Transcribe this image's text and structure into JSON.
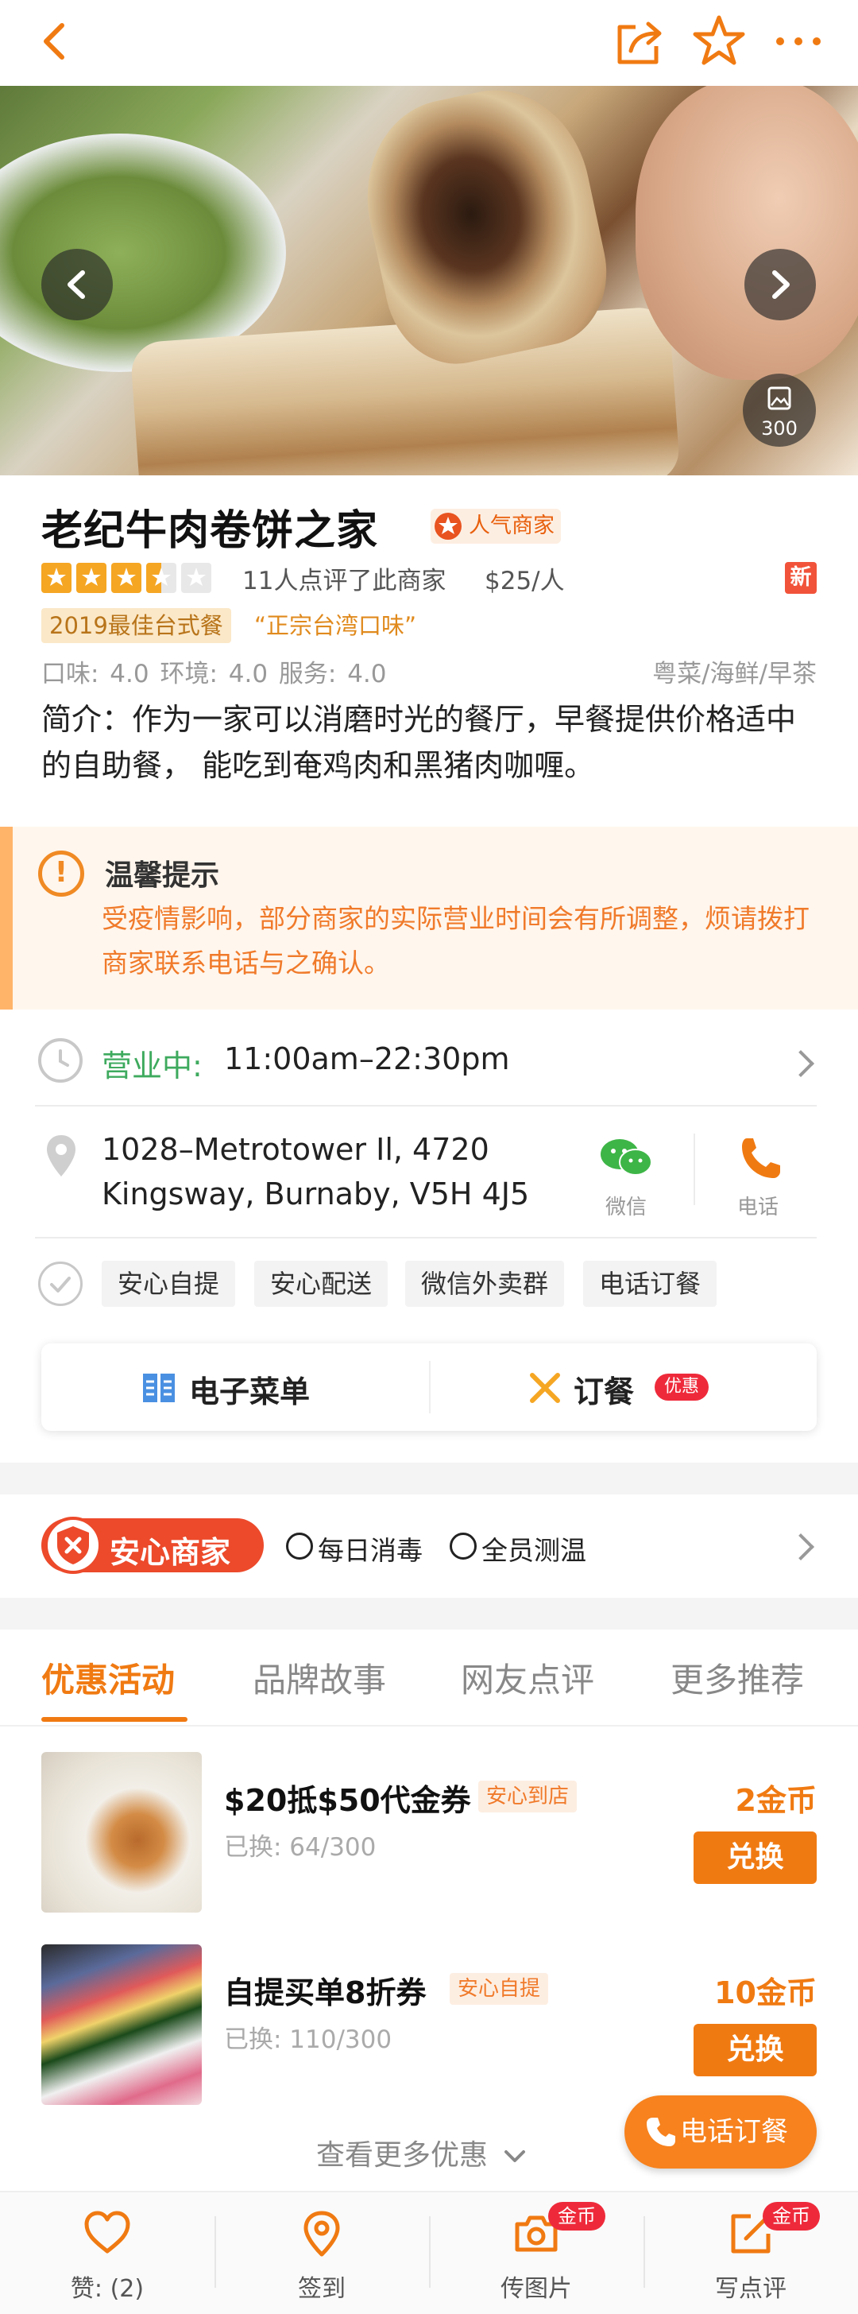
{
  "header": {},
  "hero": {
    "photo_count": "300"
  },
  "shop": {
    "name": "老纪牛肉卷饼之家",
    "popular_badge": "人气商家",
    "rating_stars": 3.5,
    "review_stats": "11人点评了此商家",
    "price": "$25/人",
    "new_badge": "新",
    "award": "2019最佳台式餐",
    "quote": "“正宗台湾口味”",
    "scores": "口味: 4.0   环境: 4.0   服务: 4.0",
    "cuisine": "粤菜/海鲜/早茶",
    "intro": "简介：作为一家可以消磨时光的餐厅，早餐提供价格适中的自助餐， 能吃到奄鸡肉和黑猪肉咖喱。"
  },
  "notice": {
    "title": "温馨提示",
    "body": "受疫情影响，部分商家的实际营业时间会有所调整，烦请拨打商家联系电话与之确认。"
  },
  "hours": {
    "label": "营业中:",
    "time": "11:00am–22:30pm"
  },
  "address": {
    "line1": "1028–Metrotower Il, 4720",
    "line2": "Kingsway, Burnaby, V5H 4J5",
    "wechat_label": "微信",
    "phone_label": "电话"
  },
  "service_tags": [
    "安心自提",
    "安心配送",
    "微信外卖群",
    "电话订餐"
  ],
  "menu_card": {
    "menu_label": "电子菜单",
    "order_label": "订餐",
    "order_badge": "优惠"
  },
  "assurance": {
    "badge": "安心商家",
    "items": [
      "每日消毒",
      "全员测温"
    ]
  },
  "tabs": [
    "优惠活动",
    "品牌故事",
    "网友点评",
    "更多推荐"
  ],
  "deals": [
    {
      "title": "$20抵$50代金券",
      "tag": "安心到店",
      "redeemed": "已换: 64/300",
      "coins": "2金币",
      "button": "兑换"
    },
    {
      "title": "自提买单8折券",
      "tag": "安心自提",
      "redeemed": "已换: 110/300",
      "coins": "10金币",
      "button": "兑换"
    }
  ],
  "more_deals": "查看更多优惠",
  "phone_order": "电话订餐",
  "bottom_bar": [
    {
      "label": "赞: (2)",
      "icon": "heart-icon"
    },
    {
      "label": "签到",
      "icon": "location-pin-icon"
    },
    {
      "label": "传图片",
      "icon": "camera-icon",
      "badge": "金币"
    },
    {
      "label": "写点评",
      "icon": "edit-icon",
      "badge": "金币"
    }
  ],
  "colors": {
    "accent": "#f07a12",
    "green": "#3eaa5e",
    "red": "#ee2a3a"
  }
}
